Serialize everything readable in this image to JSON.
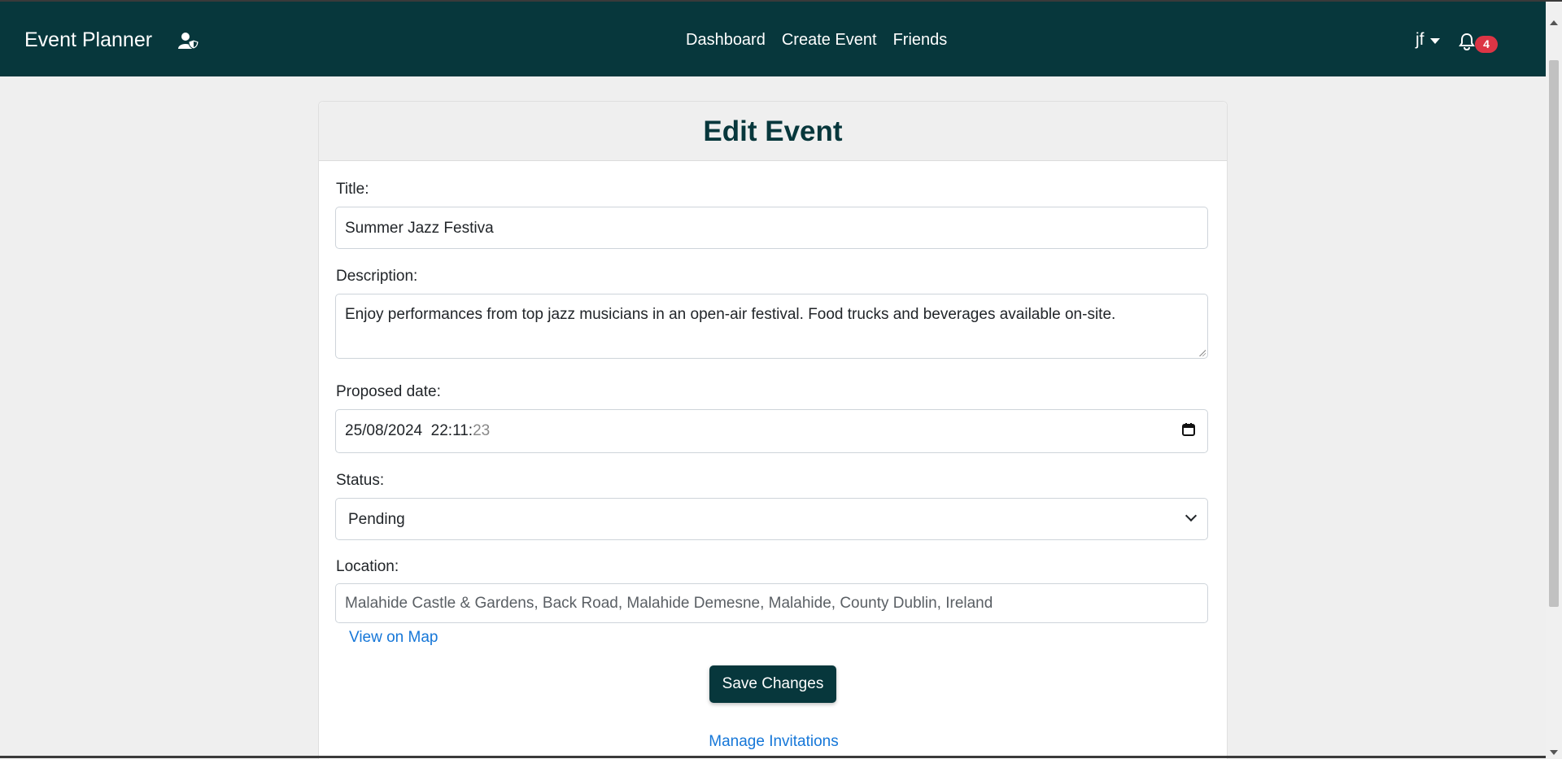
{
  "app": {
    "brand": "Event Planner",
    "icons": {
      "admin": "user-shield-icon",
      "notifications": "bell-icon",
      "calendar": "calendar-icon",
      "select": "chevron-down-icon"
    }
  },
  "nav": {
    "links": [
      "Dashboard",
      "Create Event",
      "Friends"
    ]
  },
  "user": {
    "name": "jf",
    "notifications": "4"
  },
  "form": {
    "heading": "Edit Event",
    "title_label": "Title:",
    "title_value": "Summer Jazz Festiva",
    "description_label": "Description:",
    "description_value": "Enjoy performances from top jazz musicians in an open-air festival. Food trucks and beverages available on-site.",
    "date_label": "Proposed date:",
    "date_main": "25/08/2024  22:11:",
    "date_seconds": "23",
    "status_label": "Status:",
    "status_value": "Pending",
    "location_label": "Location:",
    "location_value": "Malahide Castle & Gardens, Back Road, Malahide Demesne, Malahide, County Dublin, Ireland",
    "map_link": "View on Map",
    "save_label": "Save Changes",
    "manage_link": "Manage Invitations"
  },
  "colors": {
    "navbar": "#07373c",
    "heading": "#07373c",
    "link": "#1677d8",
    "badge": "#dc3545",
    "page_background": "#efefef"
  }
}
